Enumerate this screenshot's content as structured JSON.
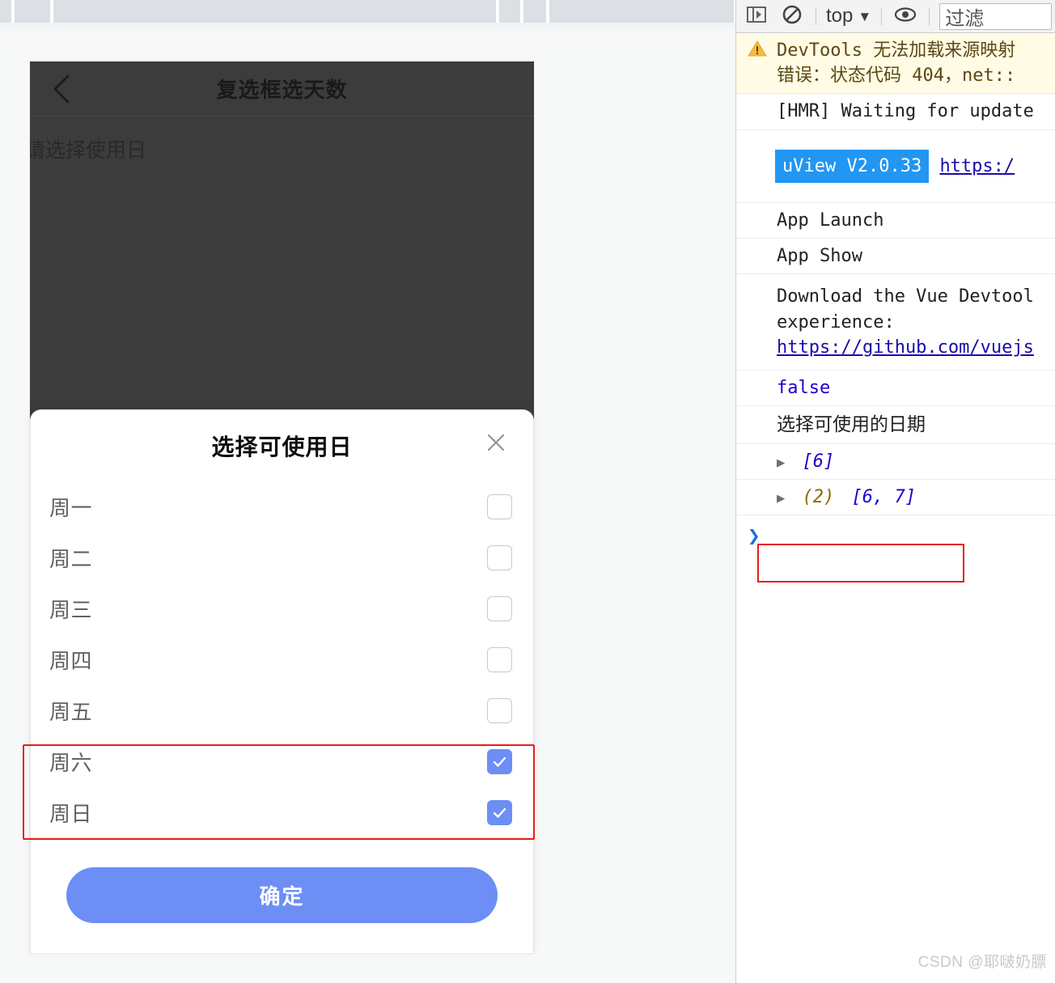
{
  "browser": {
    "chrome_segments": [
      14,
      60,
      870,
      42,
      44,
      180
    ]
  },
  "phone": {
    "title": "复选框选天数",
    "back_icon": "chevron-left-icon",
    "hint_text": "请选择使用日"
  },
  "popup": {
    "title": "选择可使用日",
    "close_icon": "close-icon",
    "days": [
      {
        "label": "周一",
        "checked": false
      },
      {
        "label": "周二",
        "checked": false
      },
      {
        "label": "周三",
        "checked": false
      },
      {
        "label": "周四",
        "checked": false
      },
      {
        "label": "周五",
        "checked": false
      },
      {
        "label": "周六",
        "checked": true
      },
      {
        "label": "周日",
        "checked": true
      }
    ],
    "confirm_label": "确定",
    "accent_color": "#6c8ef5",
    "annotation_color": "#e81b1b"
  },
  "devtools": {
    "toolbar": {
      "sidebar_icon": "sidebar-toggle-icon",
      "clear_icon": "clear-console-icon",
      "context_label": "top",
      "context_caret": "▼",
      "eye_icon": "eye-icon",
      "filter_placeholder": "过滤"
    },
    "messages": {
      "warning": {
        "icon": "warning-icon",
        "line1": "DevTools 无法加载来源映射",
        "line2": "错误：状态代码 404，net::"
      },
      "hmr": "[HMR] Waiting for update",
      "uview_badge": "uView V2.0.33",
      "uview_link": "https:/",
      "app_launch": "App Launch",
      "app_show": "App Show",
      "devtools_tip_line1": "Download the Vue Devtool",
      "devtools_tip_line2": "experience:",
      "devtools_tip_link": "https://github.com/vuejs",
      "false_value": "false",
      "cn_log": "选择可使用的日期",
      "array_1": {
        "arrow": "▶",
        "value": "[6]"
      },
      "array_2": {
        "arrow": "▶",
        "count": "(2)",
        "value": "[6, 7]"
      }
    },
    "prompt_symbol": "❯"
  },
  "watermark": "CSDN @耶啵奶膘"
}
